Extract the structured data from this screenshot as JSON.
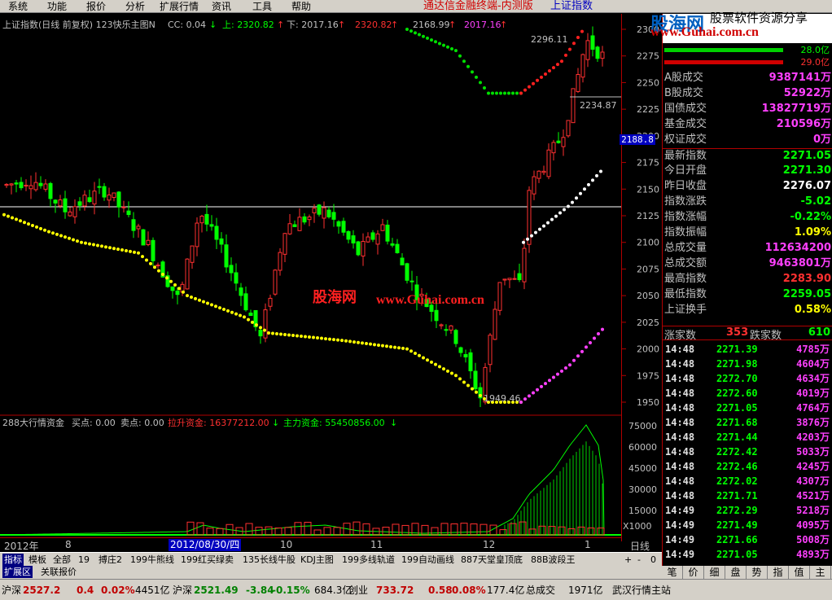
{
  "menu": {
    "items": [
      "系统",
      "功能",
      "报价",
      "分析",
      "扩展行情",
      "资讯",
      "工具",
      "帮助"
    ],
    "app_title": "通达信金融终端-内测版",
    "index_title": "上证指数"
  },
  "watermark": {
    "logo_text": "股海网",
    "logo_subtitle": "股票软件资源分享",
    "logo_url": "www.Guhai.com.cn",
    "center_text_cn": "股海网",
    "center_text_url": "www.Guhai.com.cn"
  },
  "main_header": {
    "title": "上证指数(日线 前复权) 123快乐主图N",
    "cc": "CC: 0.04",
    "up_label": "上: 2320.82",
    "down_label": "下: 2017.16",
    "v1": "2320.82",
    "v2": "2168.99",
    "v3": "2017.16"
  },
  "annotations": {
    "peak": "2296.11",
    "recent": "2234.87",
    "low": "1949.46",
    "axis_marker": "2188.8"
  },
  "indicator_header": {
    "name": "288大行情资金",
    "buy": "买点: 0.00",
    "sell": "卖点: 0.00",
    "pull": "拉升资金: 16377212.00",
    "main": "主力资金: 55450856.00"
  },
  "price_axis": [
    "2300",
    "2275",
    "2250",
    "2225",
    "2200",
    "2175",
    "2150",
    "2125",
    "2100",
    "2075",
    "2050",
    "2025",
    "2000",
    "1975",
    "1950"
  ],
  "vol_axis": [
    "75000",
    "60000",
    "45000",
    "30000",
    "15000",
    "X1000"
  ],
  "date_axis": {
    "labels": [
      "2012年",
      "8",
      "10",
      "11",
      "12",
      "1"
    ],
    "cursor_date": "2012/08/30/四",
    "period": "日线"
  },
  "right_panel": {
    "top_bars": [
      "28.0亿",
      "29.0亿"
    ],
    "stats": [
      {
        "label": "A股成交",
        "value": "9387141万",
        "color": "#ff40ff"
      },
      {
        "label": "B股成交",
        "value": "52922万",
        "color": "#ff40ff"
      },
      {
        "label": "国债成交",
        "value": "13827719万",
        "color": "#ff40ff"
      },
      {
        "label": "基金成交",
        "value": "210596万",
        "color": "#ff40ff"
      },
      {
        "label": "权证成交",
        "value": "0万",
        "color": "#ff40ff"
      },
      {
        "label": "最新指数",
        "value": "2271.05",
        "color": "#00ff00"
      },
      {
        "label": "今日开盘",
        "value": "2271.30",
        "color": "#00ff00"
      },
      {
        "label": "昨日收盘",
        "value": "2276.07",
        "color": "#ffffff"
      },
      {
        "label": "指数涨跌",
        "value": "-5.02",
        "color": "#00ff00"
      },
      {
        "label": "指数涨幅",
        "value": "-0.22%",
        "color": "#00ff00"
      },
      {
        "label": "指数振幅",
        "value": "1.09%",
        "color": "#ffff00"
      },
      {
        "label": "总成交量",
        "value": "112634200",
        "color": "#ff40ff"
      },
      {
        "label": "总成交额",
        "value": "9463801万",
        "color": "#ff40ff"
      },
      {
        "label": "最高指数",
        "value": "2283.90",
        "color": "#ff3030"
      },
      {
        "label": "最低指数",
        "value": "2259.05",
        "color": "#00ff00"
      },
      {
        "label": "上证换手",
        "value": "0.58%",
        "color": "#ffff00"
      }
    ],
    "advance": {
      "up_label": "涨家数",
      "up": "353",
      "down_label": "跌家数",
      "down": "610"
    },
    "ticks": [
      {
        "time": "14:48",
        "price": "2271.39",
        "vol": "4785万"
      },
      {
        "time": "14:48",
        "price": "2271.98",
        "vol": "4604万"
      },
      {
        "time": "14:48",
        "price": "2272.70",
        "vol": "4634万"
      },
      {
        "time": "14:48",
        "price": "2272.60",
        "vol": "4019万"
      },
      {
        "time": "14:48",
        "price": "2271.05",
        "vol": "4764万"
      },
      {
        "time": "14:48",
        "price": "2271.68",
        "vol": "3876万"
      },
      {
        "time": "14:48",
        "price": "2271.44",
        "vol": "4203万"
      },
      {
        "time": "14:48",
        "price": "2272.42",
        "vol": "5033万"
      },
      {
        "time": "14:48",
        "price": "2272.46",
        "vol": "4245万"
      },
      {
        "time": "14:48",
        "price": "2272.02",
        "vol": "4307万"
      },
      {
        "time": "14:48",
        "price": "2271.71",
        "vol": "4521万"
      },
      {
        "time": "14:49",
        "price": "2272.29",
        "vol": "5218万"
      },
      {
        "time": "14:49",
        "price": "2271.49",
        "vol": "4095万"
      },
      {
        "time": "14:49",
        "price": "2271.66",
        "vol": "5008万"
      },
      {
        "time": "14:49",
        "price": "2271.05",
        "vol": "4893万"
      }
    ],
    "tabs": [
      "笔",
      "价",
      "细",
      "盘",
      "势",
      "指",
      "值",
      "主"
    ]
  },
  "bottom_tabs": [
    "指标",
    "模板",
    "全部",
    "19",
    "搏庄2",
    "199牛熊线",
    "199红买绿卖",
    "135长线牛股",
    "KDJ主图",
    "199多线轨道",
    "199自动画线",
    "887天堂皇顶底",
    "88B波段王"
  ],
  "tab_controls": [
    "+",
    "-",
    "0"
  ],
  "sub_tabs": [
    "扩展区",
    "关联报价"
  ],
  "status": [
    {
      "text": "沪深",
      "color": "#000000"
    },
    {
      "text": "2527.2",
      "color": "#c00000"
    },
    {
      "text": "0.4",
      "color": "#c00000"
    },
    {
      "text": "0.02%",
      "color": "#c00000"
    },
    {
      "text": "4451亿",
      "color": "#000000"
    },
    {
      "text": "沪深",
      "color": "#000000"
    },
    {
      "text": "2521.49",
      "color": "#008000"
    },
    {
      "text": "-3.84",
      "color": "#008000"
    },
    {
      "text": "-0.15%",
      "color": "#008000"
    },
    {
      "text": "684.3亿",
      "color": "#000000"
    },
    {
      "text": "创业",
      "color": "#000000"
    },
    {
      "text": "733.72",
      "color": "#c00000"
    },
    {
      "text": "0.58",
      "color": "#c00000"
    },
    {
      "text": "0.08%",
      "color": "#c00000"
    },
    {
      "text": "177.4亿",
      "color": "#000000"
    },
    {
      "text": "总成交",
      "color": "#000000"
    },
    {
      "text": "1971亿",
      "color": "#000000"
    },
    {
      "text": "武汉行情主站",
      "color": "#000000"
    }
  ]
}
